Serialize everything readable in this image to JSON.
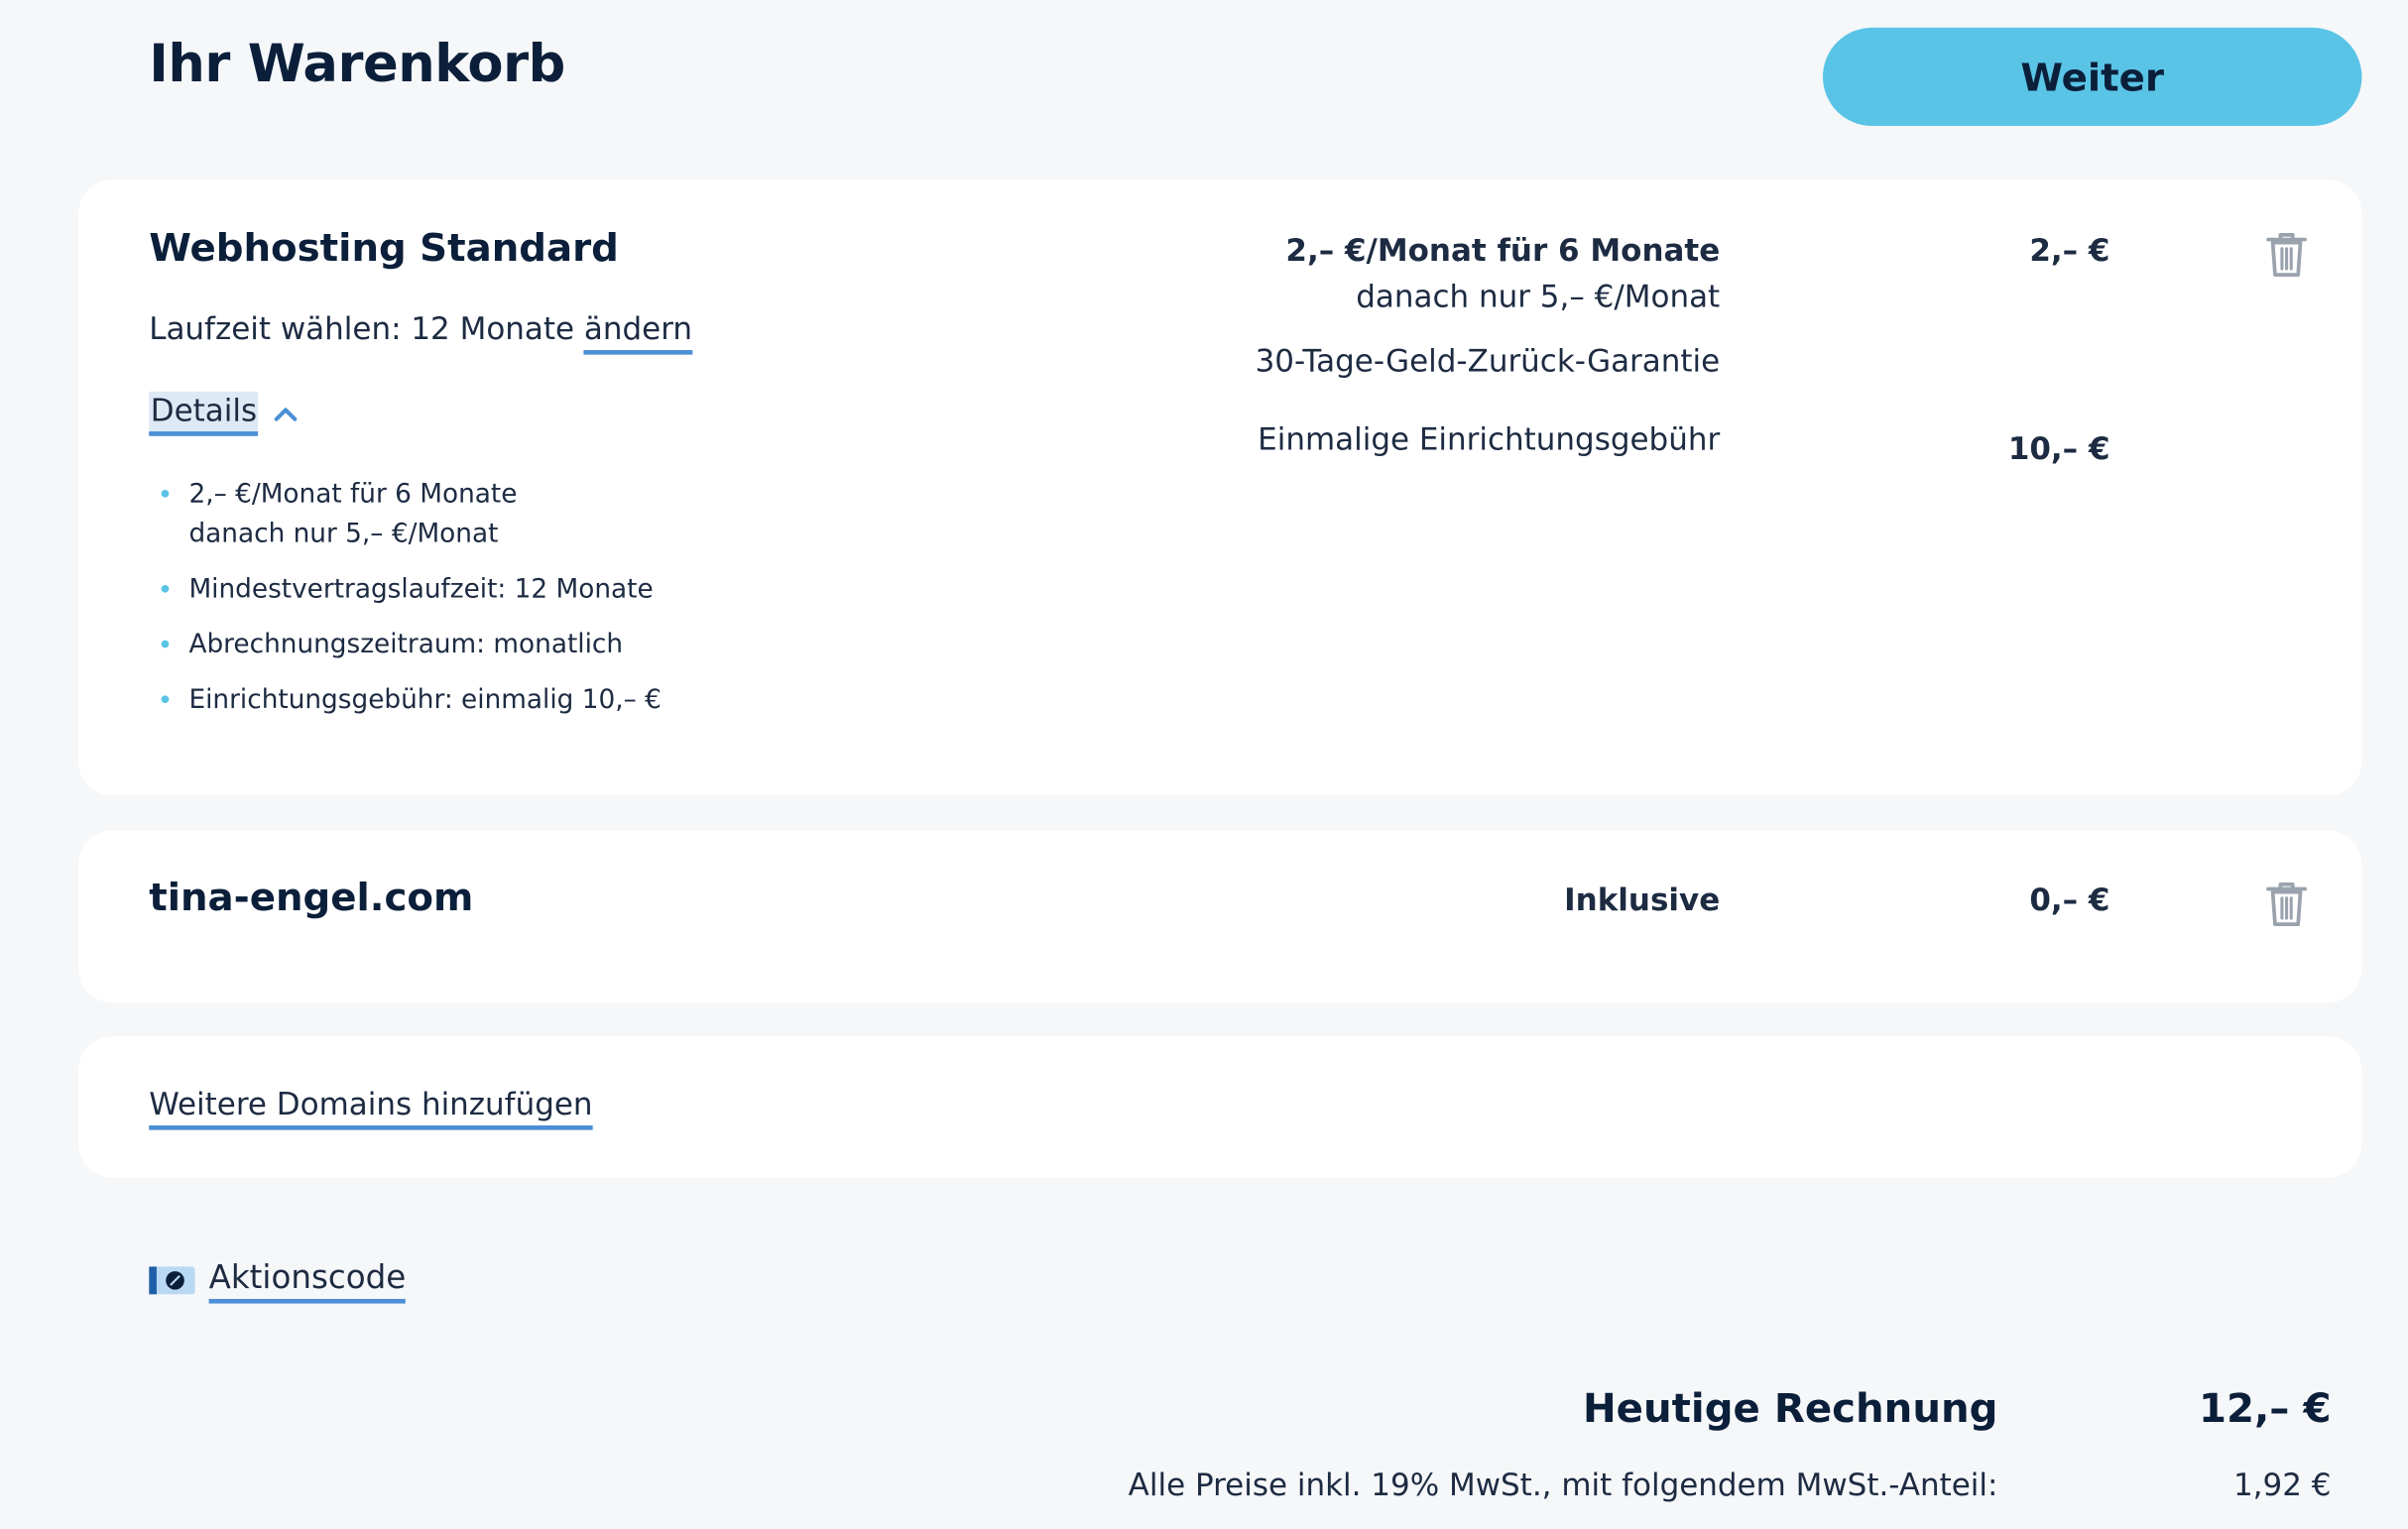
{
  "header": {
    "title": "Ihr Warenkorb",
    "continue_label": "Weiter"
  },
  "cart": {
    "hosting": {
      "name": "Webhosting Standard",
      "term_prefix": "Laufzeit wählen: 12 Monate",
      "term_change_label": "ändern",
      "details_label": "Details",
      "details_items": [
        {
          "line1": "2,– €/Monat für 6 Monate",
          "line2": "danach nur 5,– €/Monat"
        },
        {
          "line1": "Mindestvertragslaufzeit: 12 Monate"
        },
        {
          "line1": "Abrechnungszeitraum: monatlich"
        },
        {
          "line1": "Einrichtungsgebühr: einmalig 10,– €"
        }
      ],
      "promo_price": "2,– €/Monat für 6 Monate",
      "regular_price": "danach nur 5,– €/Monat",
      "guarantee": "30-Tage-Geld-Zurück-Garantie",
      "setup_fee_label": "Einmalige Einrichtungsgebühr",
      "price": "2,– €",
      "setup_fee": "10,– €"
    },
    "domain": {
      "name": "tina-engel.com",
      "status": "Inklusive",
      "price": "0,– €"
    },
    "add_domains_label": "Weitere Domains hinzufügen",
    "promo_code_label": "Aktionscode"
  },
  "summary": {
    "total_label": "Heutige Rechnung",
    "total_amount": "12,– €",
    "tax_label": "Alle Preise inkl. 19% MwSt., mit folgendem MwSt.-Anteil:",
    "tax_amount": "1,92 €"
  },
  "icons": {
    "delete": "trash-icon",
    "coupon": "coupon-icon",
    "collapse": "chevron-up-icon"
  },
  "colors": {
    "accent": "#59c4e6",
    "link_underline": "#4b8fd6",
    "text": "#0b1f3a",
    "background": "#f5f7f9"
  }
}
